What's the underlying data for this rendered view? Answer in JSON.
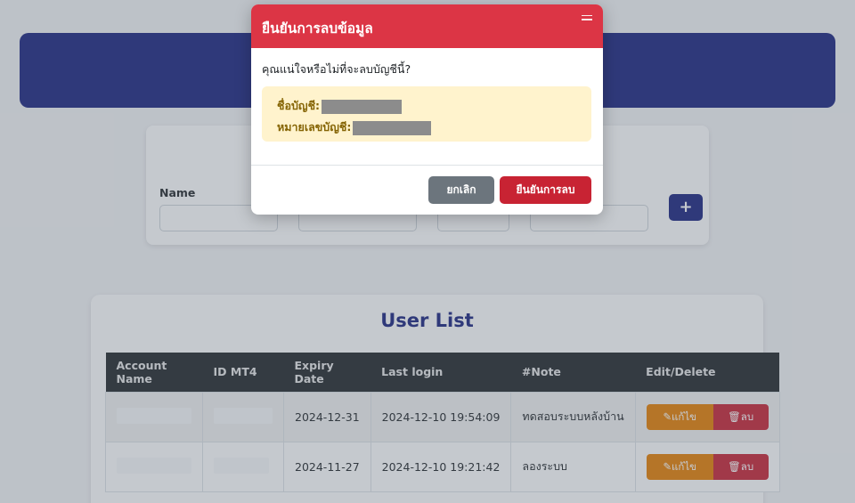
{
  "add_form": {
    "name_label": "Name",
    "add_button_label": "+"
  },
  "user_list": {
    "title": "User List",
    "columns": [
      "Account Name",
      "ID MT4",
      "Expiry Date",
      "Last login",
      "#Note",
      "Edit/Delete"
    ],
    "rows": [
      {
        "expiry": "2024-12-31",
        "last_login": "2024-12-10 19:54:09",
        "note": "ทดสอบระบบหลังบ้าน"
      },
      {
        "expiry": "2024-11-27",
        "last_login": "2024-12-10 19:21:42",
        "note": "ลองระบบ"
      }
    ],
    "edit_label": "แก้ไข",
    "delete_label": "ลบ"
  },
  "modal": {
    "title": "ยืนยันการลบข้อมูล",
    "question": "คุณแน่ใจหรือไม่ที่จะลบบัญชีนี้?",
    "account_name_label": "ชื่อบัญชี:",
    "account_number_label": "หมายเลขบัญชี:",
    "cancel_label": "ยกเลิก",
    "confirm_label": "ยืนยันการลบ"
  },
  "icons": {
    "edit": "edit-icon",
    "delete": "trash-icon",
    "close": "close-icon"
  },
  "colors": {
    "brand": "#1a237e",
    "danger": "#dc3545",
    "warning": "#e67e00",
    "secondary": "#6c757d"
  }
}
